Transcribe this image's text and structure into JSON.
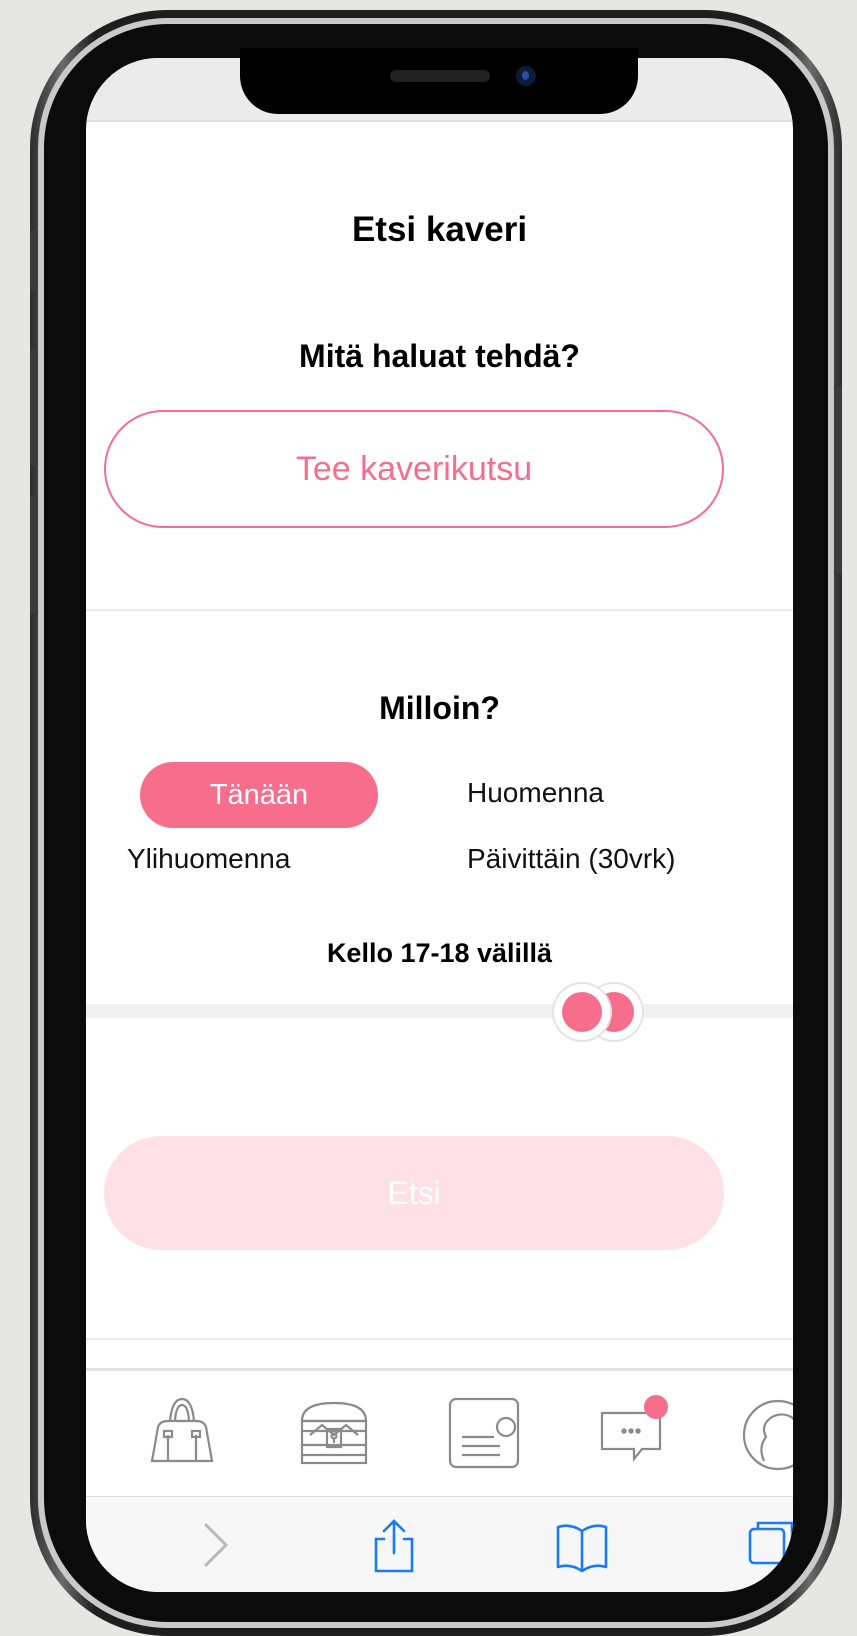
{
  "page": {
    "title": "Etsi kaveri"
  },
  "activity": {
    "question": "Mitä haluat tehdä?",
    "invite_button": "Tee kaverikutsu"
  },
  "when": {
    "question": "Milloin?",
    "options": [
      "Tänään",
      "Huomenna",
      "Ylihuomenna",
      "Päivittäin (30vrk)"
    ],
    "selected": "Tänään"
  },
  "time": {
    "label": "Kello 17-18 välillä",
    "range_start_hour": 17,
    "range_end_hour": 18
  },
  "search": {
    "button": "Etsi",
    "enabled": false
  },
  "tab_bar": {
    "items": [
      "bag-icon",
      "treasure-chest-icon",
      "card-icon",
      "chat-icon",
      "profile-icon"
    ],
    "chat_has_notification": true
  },
  "safari_toolbar": {
    "items": [
      "forward-icon",
      "share-icon",
      "bookmarks-icon",
      "tabs-icon"
    ]
  },
  "colors": {
    "accent": "#f66e8c",
    "accent_light": "#fde1e7",
    "ios_blue": "#1a7cf5"
  }
}
